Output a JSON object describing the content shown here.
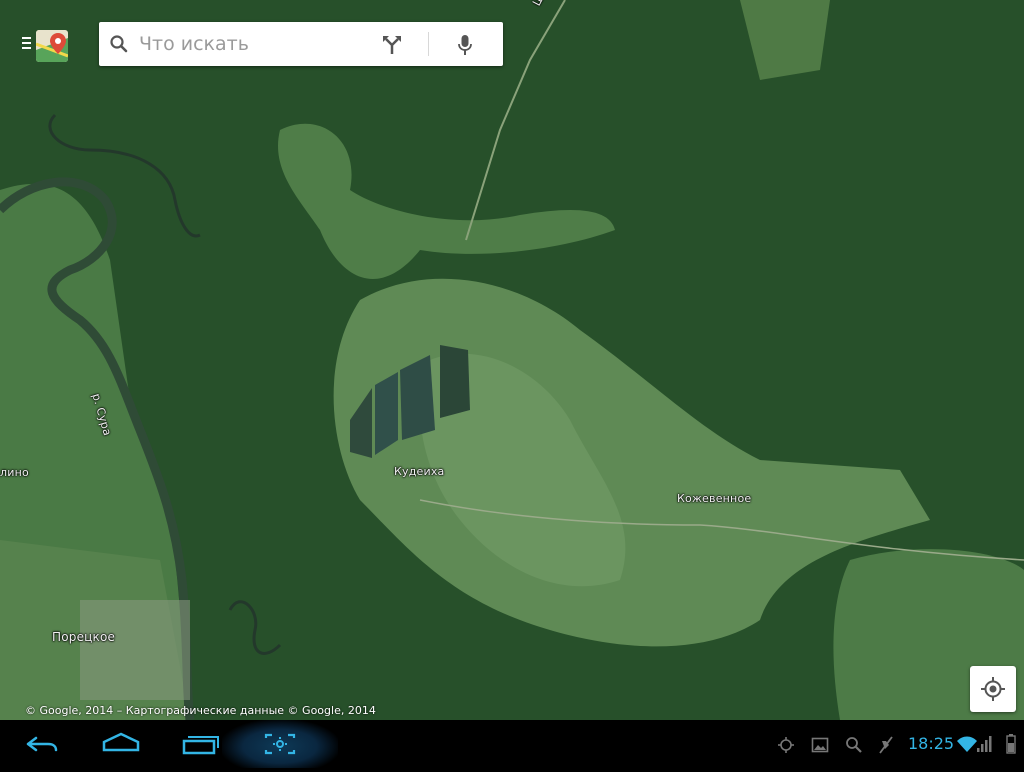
{
  "search": {
    "placeholder": "Что искать"
  },
  "map": {
    "labels": {
      "road": "Шоссейн",
      "river": "р. Сура",
      "village_left_partial": "лино",
      "kudeiha": "Кудеиха",
      "kozhevennoe": "Кожевенное",
      "poretskoe": "Порецкое"
    },
    "copyright": "© Google, 2014 – Картографические данные © Google, 2014"
  },
  "status_bar": {
    "time": "18:25"
  },
  "colors": {
    "clock": "#33b5e5",
    "nav_highlight": "#0e3a57"
  }
}
